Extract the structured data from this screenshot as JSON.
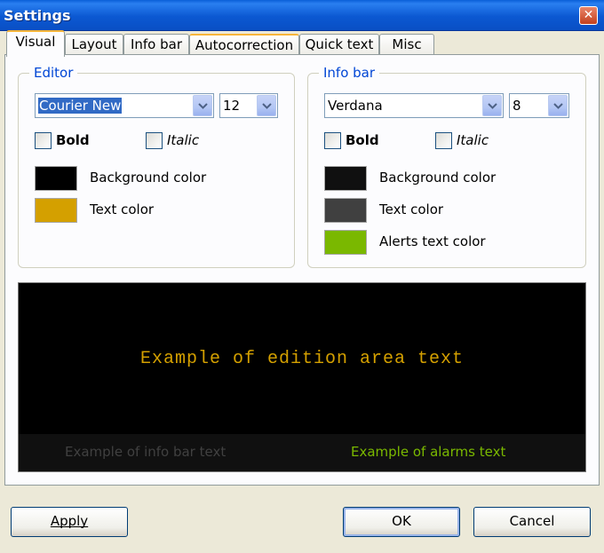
{
  "window": {
    "title": "Settings"
  },
  "tabs": [
    {
      "label": "Visual"
    },
    {
      "label": "Layout"
    },
    {
      "label": "Info bar"
    },
    {
      "label": "Autocorrection"
    },
    {
      "label": "Quick text"
    },
    {
      "label": "Misc"
    }
  ],
  "editor": {
    "legend": "Editor",
    "font": "Courier New",
    "size": "12",
    "bold_label": "Bold",
    "italic_label": "Italic",
    "bg_label": "Background color",
    "text_label": "Text color",
    "bg_color": "#000000",
    "text_color": "#d4a000"
  },
  "infobar": {
    "legend": "Info bar",
    "font": "Verdana",
    "size": "8",
    "bold_label": "Bold",
    "italic_label": "Italic",
    "bg_label": "Background color",
    "text_label": "Text color",
    "alerts_label": "Alerts text color",
    "bg_color": "#101010",
    "text_color": "#404040",
    "alerts_color": "#7ab800"
  },
  "preview": {
    "main_text": "Example of edition area text",
    "info_text": "Example of info bar text",
    "alarm_text": "Example of alarms text"
  },
  "buttons": {
    "apply": "Apply",
    "ok": "OK",
    "cancel": "Cancel"
  }
}
